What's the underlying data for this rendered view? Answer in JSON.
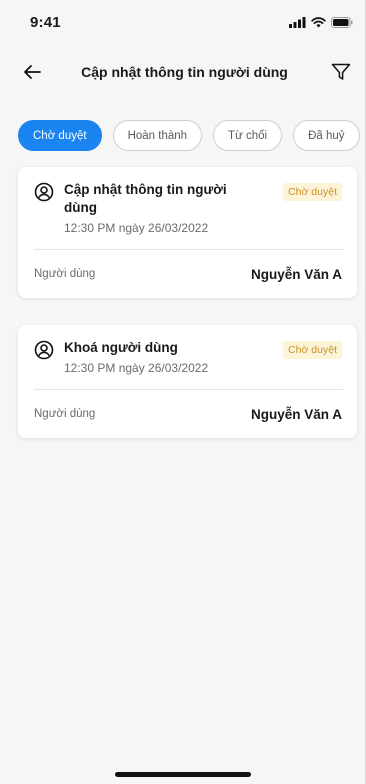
{
  "status_bar": {
    "time": "9:41"
  },
  "nav": {
    "title": "Cập nhật thông tin người dùng"
  },
  "tabs": [
    {
      "label": "Chờ duyệt",
      "active": true
    },
    {
      "label": "Hoàn thành",
      "active": false
    },
    {
      "label": "Từ chối",
      "active": false
    },
    {
      "label": "Đã huỷ",
      "active": false
    }
  ],
  "requests": [
    {
      "title": "Cập nhật thông tin người dùng",
      "time": "12:30 PM ngày 26/03/2022",
      "status": "Chờ duyệt",
      "field_label": "Người dùng",
      "field_value": "Nguyễn Văn A"
    },
    {
      "title": "Khoá người dùng",
      "time": "12:30 PM ngày 26/03/2022",
      "status": "Chờ duyệt",
      "field_label": "Người dùng",
      "field_value": "Nguyễn Văn A"
    }
  ],
  "colors": {
    "accent": "#1a84f0",
    "badge_bg": "#fdf3d6",
    "badge_text": "#c9902a",
    "background": "#f6f6f7"
  },
  "icons": {
    "back": "arrow-left-icon",
    "filter": "filter-icon",
    "user": "user-circle-icon",
    "signal": "signal-icon",
    "wifi": "wifi-icon",
    "battery": "battery-icon"
  }
}
